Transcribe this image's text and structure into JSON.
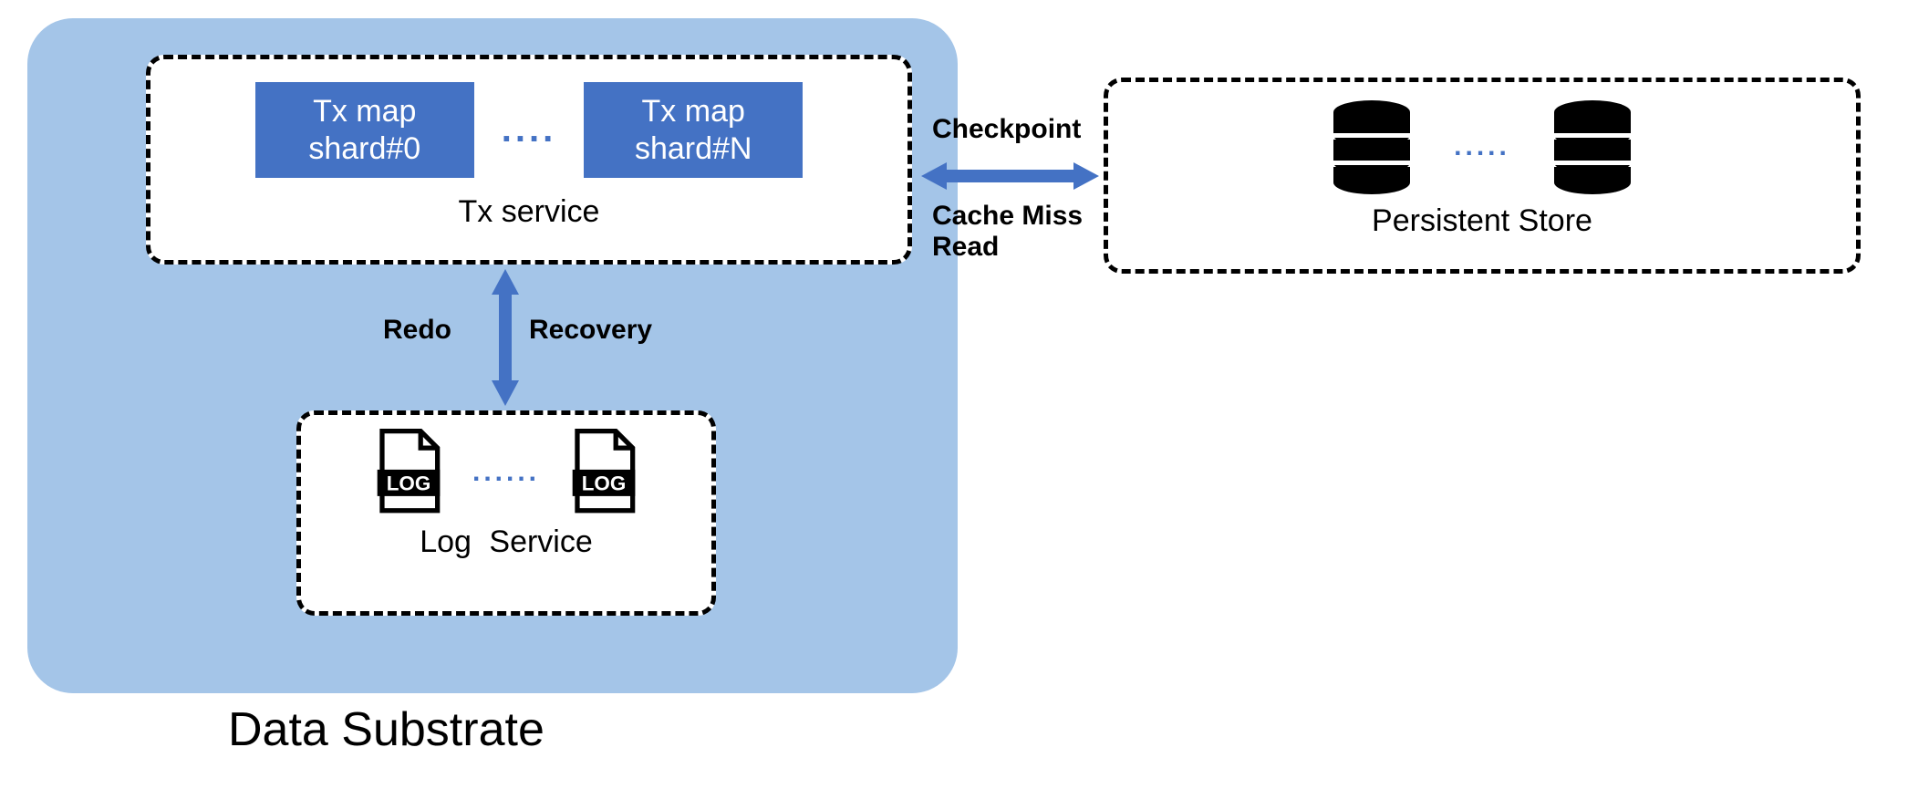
{
  "substrate": {
    "title": "Data Substrate"
  },
  "tx_service": {
    "label": "Tx service",
    "shard0_line1": "Tx map",
    "shard0_line2": "shard#0",
    "shardN_line1": "Tx map",
    "shardN_line2": "shard#N",
    "dots": "...."
  },
  "log_service": {
    "label": "Log  Service",
    "dots": "......",
    "icon_text": "LOG"
  },
  "persistent_store": {
    "label": "Persistent Store",
    "dots": "....."
  },
  "edges": {
    "checkpoint": "Checkpoint",
    "cache_miss": "Cache Miss Read",
    "redo": "Redo",
    "recovery": "Recovery"
  },
  "colors": {
    "substrate_bg": "#a4c5e8",
    "shard_bg": "#4472c4",
    "arrow": "#4472c4"
  }
}
